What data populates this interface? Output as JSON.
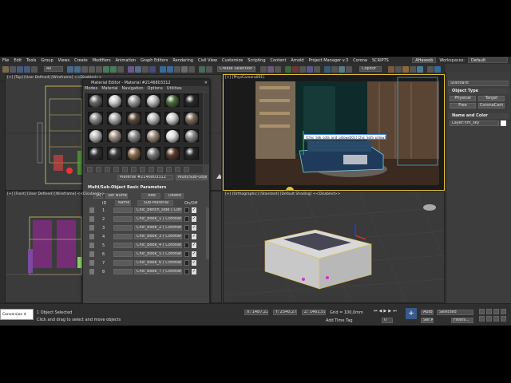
{
  "menu": {
    "items": [
      "File",
      "Edit",
      "Tools",
      "Group",
      "Views",
      "Create",
      "Modifiers",
      "Animation",
      "Graph Editors",
      "Rendering",
      "Civil View",
      "Customize",
      "Scripting",
      "Content",
      "Arnold",
      "Project Manager v.3",
      "Corona",
      "SCRIPTS"
    ],
    "user": "AHaseeb",
    "workspaces_label": "Workspaces:",
    "workspace_value": "Default"
  },
  "toolbar": {
    "filter_value": "All",
    "selection_set": "Create Selection Set",
    "copitor": "Copitor"
  },
  "viewports": {
    "top": "[+] [Top] [User Defined] [Wireframe] <<Disabled>>",
    "camera": "[+] [PhysCamera001]",
    "front": "[+] [Front] [User Defined] [Wireframe] <<Disabled>>",
    "ortho": "[+] [Orthographic] [Standard] [Default Shading] <<Disabled>>",
    "tooltip": "[Chic_Silk_sofa_and_pillows001] Chic_Sofa_pillow1"
  },
  "material_editor": {
    "title": "Material Editor - Material #2146803312",
    "menu": [
      "Modes",
      "Material",
      "Navigation",
      "Options",
      "Utilities"
    ],
    "material_name": "Material #2146803312",
    "material_type": "Multi/Sub-Object",
    "panel_title": "Multi/Sub-Object Basic Parameters",
    "count": "10",
    "set_number": "Set Number",
    "add": "Add",
    "delete": "Delete",
    "headers": {
      "id": "ID",
      "name": "Name",
      "sub": "Sub-Material",
      "onoff": "On/Off"
    },
    "rows": [
      {
        "id": "1",
        "sub": "Chic_bench_side ( CoronaMtl )"
      },
      {
        "id": "2",
        "sub": "Chic_book_1 ( CoronaMtl )"
      },
      {
        "id": "3",
        "sub": "Chic_book_2 ( CoronaMtl )"
      },
      {
        "id": "4",
        "sub": "Chic_book_3 ( CoronaMtl )"
      },
      {
        "id": "5",
        "sub": "Chic_book_4 ( CoronaMtl )"
      },
      {
        "id": "6",
        "sub": "Chic_book_5 ( CoronaMtl )"
      },
      {
        "id": "7",
        "sub": "Chic_book_6 ( CoronaMtl )"
      },
      {
        "id": "8",
        "sub": "Chic_book_7 ( CoronaMtl )"
      }
    ]
  },
  "command_panel": {
    "dropdown": "Standard",
    "object_type": "Object Type",
    "buttons": [
      "Physical",
      "Target",
      "Free",
      "CoronaCam"
    ],
    "name_color": "Name and Color",
    "name_value": "Layer:hm_sky"
  },
  "status": {
    "script": "Conversion d",
    "selected": "1 Object Selected",
    "hint": "Click and drag to select and move objects",
    "x": "X: 1487,224m",
    "y": "Y: 2540,277m",
    "z": "Z: 1461,515m",
    "grid": "Grid = 100,0mm",
    "add_time_tag": "Add Time Tag",
    "auto": "Auto",
    "set_k": "Set K.",
    "selected_drop": "Selected",
    "filters": "Filters...",
    "frame": "0"
  },
  "colors": {
    "accent": "#e4c23c",
    "selection": "#3a8cff"
  }
}
